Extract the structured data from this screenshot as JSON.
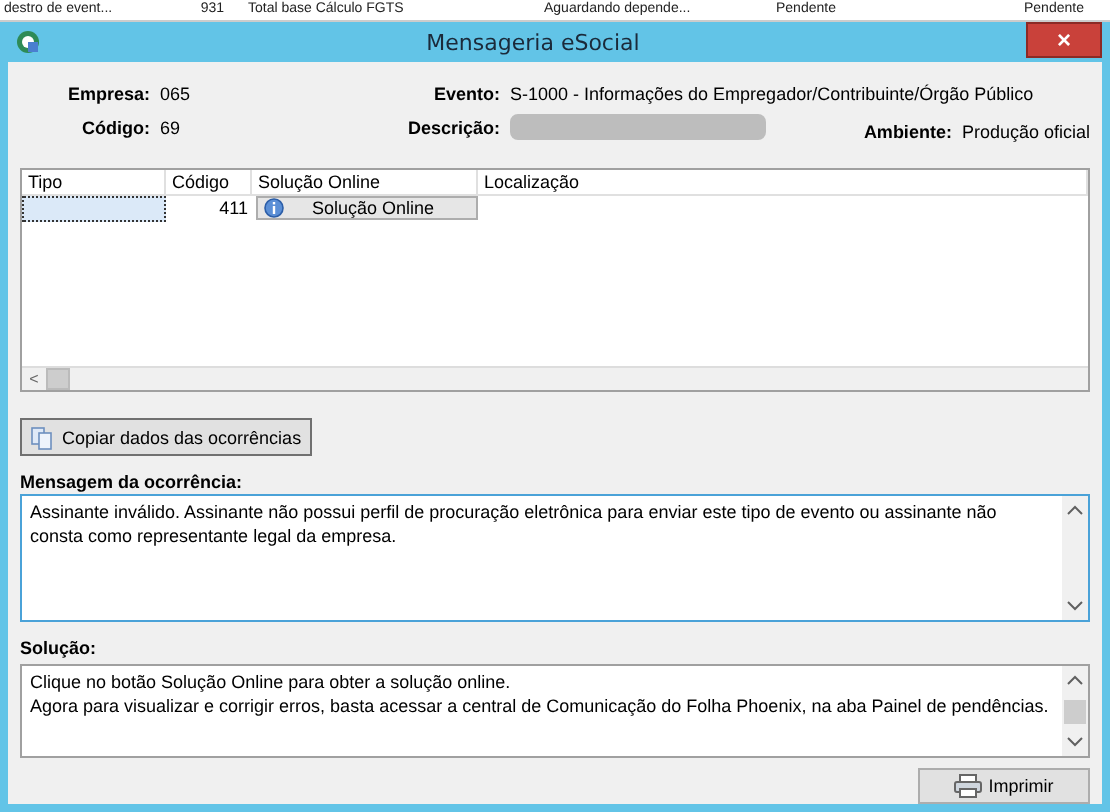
{
  "background_row": [
    "destro de event...",
    "931",
    "Total base Cálculo FGTS",
    "Aguardando depende...",
    "Pendente",
    "Pendente"
  ],
  "window": {
    "title": "Mensageria eSocial",
    "close": "×"
  },
  "header": {
    "empresa": {
      "label": "Empresa:",
      "value": "065"
    },
    "codigo": {
      "label": "Código:",
      "value": "69"
    },
    "evento": {
      "label": "Evento:",
      "value": "S-1000 - Informações do Empregador/Contribuinte/Órgão Público"
    },
    "descricao": {
      "label": "Descrição:"
    },
    "ambiente": {
      "label": "Ambiente:",
      "value": "Produção oficial"
    }
  },
  "table": {
    "columns": [
      "Tipo",
      "Código",
      "Solução Online",
      "Localização"
    ],
    "rows": [
      {
        "codigo": "411",
        "solucao_button": "Solução Online",
        "selected": true
      }
    ],
    "scroll_left": "<"
  },
  "copy_button": "Copiar dados das ocorrências",
  "mensagem": {
    "label": "Mensagem da ocorrência:",
    "text": "Assinante inválido. Assinante não possui perfil de procuração eletrônica para enviar este tipo de evento ou assinante não consta como representante legal da empresa."
  },
  "solucao": {
    "label": "Solução:",
    "lines": [
      "Clique no botão Solução Online para obter a solução online.",
      "Agora para visualizar e corrigir erros, basta acessar a central de Comunicação do Folha Phoenix, na aba Painel de pendências."
    ]
  },
  "print_button": "Imprimir"
}
